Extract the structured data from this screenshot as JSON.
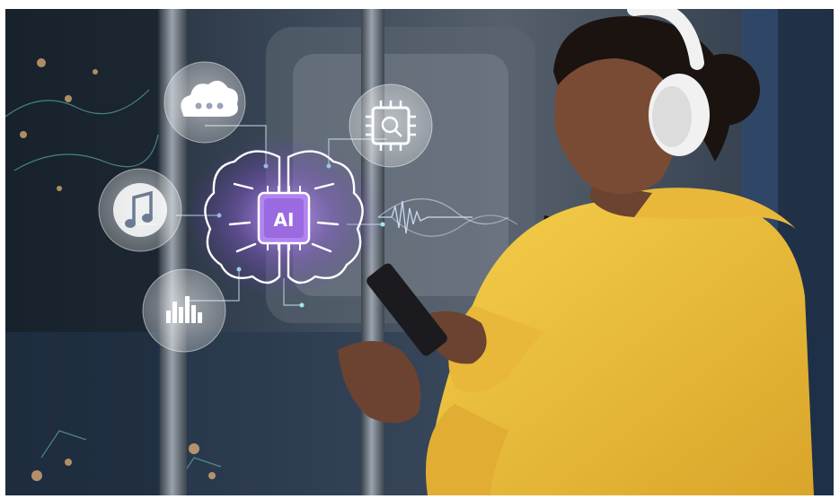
{
  "scene": {
    "chip_text": "AI",
    "colors": {
      "hoodie": "#f2c53d",
      "accent_purple": "#a47be0",
      "headphones": "#f1f1f1",
      "background_blue": "#2e3c4f"
    },
    "icons": [
      "cloud-icon",
      "music-note-icon",
      "equalizer-icon",
      "processor-chip-icon",
      "ai-brain-icon",
      "sound-wave-icon"
    ]
  }
}
